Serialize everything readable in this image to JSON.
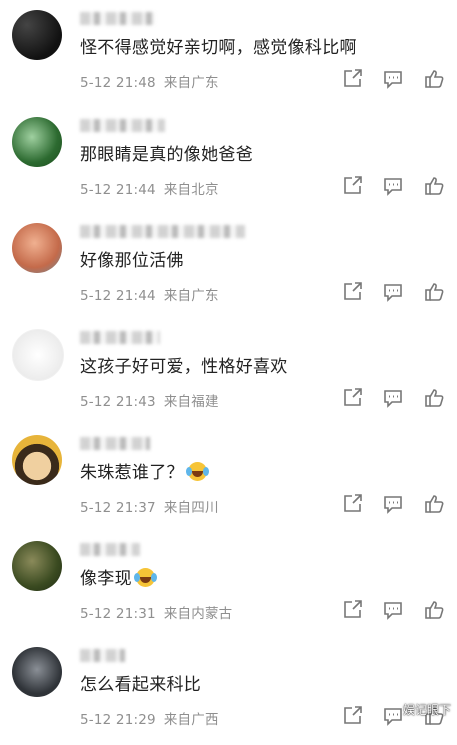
{
  "comments": [
    {
      "text": "怪不得感觉好亲切啊，感觉像科比啊",
      "time": "5-12 21:48",
      "location": "来自广东",
      "avatar_color": "#1e1e1e"
    },
    {
      "text": "那眼睛是真的像她爸爸",
      "time": "5-12 21:44",
      "location": "来自北京",
      "avatar_color": "#3a7a3c"
    },
    {
      "text": "好像那位活佛",
      "time": "5-12 21:44",
      "location": "来自广东",
      "avatar_color": "#d0805a"
    },
    {
      "text": "这孩子好可爱，性格好喜欢",
      "time": "5-12 21:43",
      "location": "来自福建",
      "avatar_color": "#f2f2f2"
    },
    {
      "text": "朱珠惹谁了？",
      "time": "5-12 21:37",
      "location": "来自四川",
      "avatar_color": "#e7b43a",
      "emoji": "laughing-crying-emoji"
    },
    {
      "text": "像李现",
      "time": "5-12 21:31",
      "location": "来自内蒙古",
      "avatar_color": "#4f5a30",
      "emoji": "laughing-crying-emoji"
    },
    {
      "text": "怎么看起来科比",
      "time": "5-12 21:29",
      "location": "来自广西",
      "avatar_color": "#2f3338"
    }
  ],
  "icons": {
    "share": "share-icon",
    "reply": "comment-icon",
    "like": "thumbs-up-icon"
  },
  "watermark": "娱记眼下"
}
